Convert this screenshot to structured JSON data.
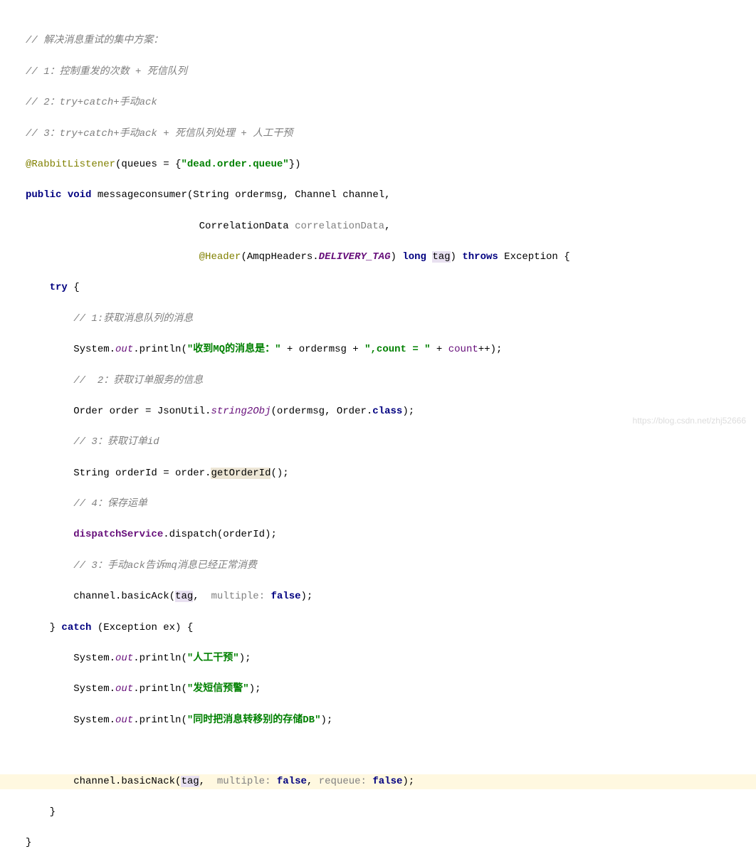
{
  "lines": {
    "c1": "// 解决消息重试的集中方案：",
    "c2": "// 1：控制重发的次数 + 死信队列",
    "c3": "// 2：try+catch+手动ack",
    "c4": "// 3：try+catch+手动ack + 死信队列处理 + 人工干预",
    "ann": "@RabbitListener",
    "annRest": "(queues = {",
    "annQueue": "\"dead.order.queue\"",
    "annEnd": "})",
    "kwPublic": "public",
    "kwVoid": "void",
    "methodName": "messageconsumer",
    "sigRest1": "(String ordermsg, Channel channel,",
    "sigLine2a": "                             CorrelationData ",
    "corrData": "correlationData",
    "sigLine2b": ",",
    "sigLine3a": "                             ",
    "headerAnn": "@Header",
    "sigLine3b": "(AmqpHeaders.",
    "deliveryTag": "DELIVERY_TAG",
    "sigLine3c": ") ",
    "kwLong": "long",
    "paramTag": "tag",
    "sigLine3d": ") ",
    "kwThrows": "throws",
    "sigLine3e": " Exception {",
    "kwTry": "try",
    "tryBrace": " {",
    "c5": "// 1:获取消息队列的消息",
    "sysOut1a": "        System.",
    "out": "out",
    "println": ".println(",
    "str1": "\"收到MQ的消息是：\"",
    "plus1": " + ordermsg + ",
    "str2": "\",count = \"",
    "plus2": " + ",
    "countVar": "count",
    "plusPlus": "++);",
    "c6": "//  2：获取订单服务的信息",
    "orderLine1": "        Order order = JsonUtil.",
    "string2Obj": "string2Obj",
    "orderLine2": "(ordermsg, Order.",
    "kwClass": "class",
    "orderLine3": ");",
    "c7": "// 3：获取订单id",
    "idLine1": "        String orderId = order.",
    "getOrderId": "getOrderId",
    "idLine2": "();",
    "c8": "// 4：保存运单",
    "dispatchSvc": "dispatchService",
    "dispatchLine": ".dispatch(orderId);",
    "c9": "// 3：手动ack告诉mq消息已经正常消费",
    "ackLine1": "        channel.basicAck(",
    "ackLine2": ",  ",
    "multipleParam": "multiple:",
    "kwFalse": "false",
    "ackLine3": ");",
    "catchLine1": "    } ",
    "kwCatch": "catch",
    "catchLine2": " (Exception ex) {",
    "sysOut2": "        System.",
    "str3": "\"人工干预\"",
    "str4": "\"发短信预警\"",
    "str5": "\"同时把消息转移别的存储DB\"",
    "closeParen": ");",
    "nackLine1": "        channel.basicNack(",
    "nackLine2": ",  ",
    "nackLine3": ", ",
    "requeueParam": "requeue:",
    "nackLine4": ");",
    "closeBrace1": "    }",
    "closeBrace2": "}"
  },
  "watermark": "https://blog.csdn.net/zhj52666"
}
